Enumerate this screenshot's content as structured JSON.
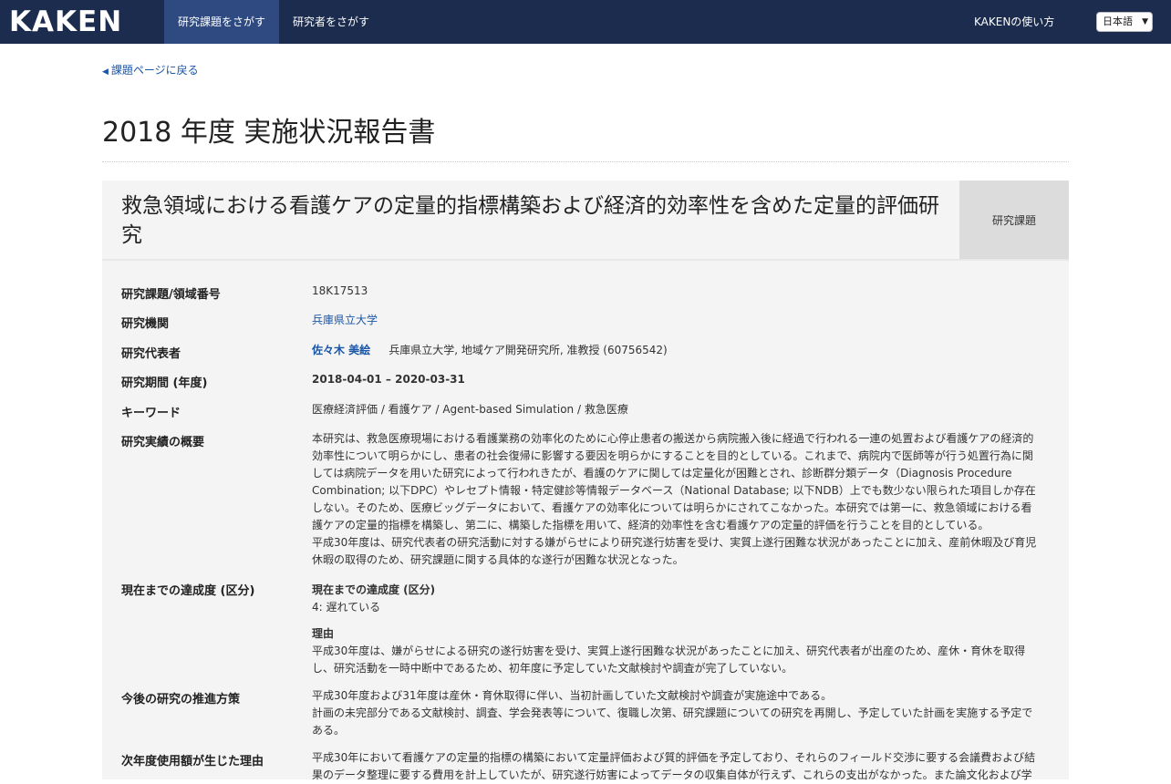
{
  "navbar": {
    "logo": "KAKEN",
    "tabs": [
      {
        "label": "研究課題をさがす"
      },
      {
        "label": "研究者をさがす"
      }
    ],
    "help_label": "KAKENの使い方",
    "language": "日本語"
  },
  "back_link": "課題ページに戻る",
  "page_title": "2018 年度 実施状況報告書",
  "project": {
    "title": "救急領域における看護ケアの定量的指標構築および経済的効率性を含めた定量的評価研究",
    "badge": "研究課題"
  },
  "rows": {
    "number": {
      "label": "研究課題/領域番号",
      "value": "18K17513"
    },
    "institution": {
      "label": "研究機関",
      "value": "兵庫県立大学"
    },
    "pi": {
      "label": "研究代表者",
      "name": "佐々木 美絵",
      "affiliation": "兵庫県立大学, 地域ケア開発研究所, 准教授 (60756542)"
    },
    "period": {
      "label": "研究期間 (年度)",
      "value": "2018-04-01 – 2020-03-31"
    },
    "keywords": {
      "label": "キーワード",
      "value": "医療経済評価 / 看護ケア / Agent-based Simulation / 救急医療"
    },
    "summary": {
      "label": "研究実績の概要",
      "para1": "本研究は、救急医療現場における看護業務の効率化のために心停止患者の搬送から病院搬入後に経過で行われる一連の処置および看護ケアの経済的効率性について明らかにし、患者の社会復帰に影響する要因を明らかにすることを目的としている。これまで、病院内で医師等が行う処置行為に関しては病院データを用いた研究によって行われきたが、看護のケアに関しては定量化が困難とされ、診断群分類データ（Diagnosis Procedure Combination; 以下DPC）やレセプト情報・特定健診等情報データベース（National Database; 以下NDB）上でも数少ない限られた項目しか存在しない。そのため、医療ビッグデータにおいて、看護ケアの効率化については明らかにされてこなかった。本研究では第一に、救急領域における看護ケアの定量的指標を構築し、第二に、構築した指標を用いて、経済的効率性を含む看護ケアの定量的評価を行うことを目的としている。",
      "para2": "平成30年度は、研究代表者の研究活動に対する嫌がらせにより研究遂行妨害を受け、実質上遂行困難な状況があったことに加え、産前休暇及び育児休暇の取得のため、研究課題に関する具体的な遂行が困難な状況となった。"
    },
    "progress": {
      "label": "現在までの達成度 (区分)",
      "sub_label": "現在までの達成度 (区分)",
      "value": "4: 遅れている",
      "reason_label": "理由",
      "reason": "平成30年度は、嫌がらせによる研究の遂行妨害を受け、実質上遂行困難な状況があったことに加え、研究代表者が出産のため、産休・育休を取得し、研究活動を一時中断中であるため、初年度に予定していた文献検討や調査が完了していない。"
    },
    "plan": {
      "label": "今後の研究の推進方策",
      "para1": "平成30年度および31年度は産休・育休取得に伴い、当初計画していた文献検討や調査が実施途中である。",
      "para2": "計画の未完部分である文献検討、調査、学会発表等について、復職し次第、研究課題についての研究を再開し、予定していた計画を実施する予定である。"
    },
    "carryover": {
      "label": "次年度使用額が生じた理由",
      "para1": "平成30年において看護ケアの定量的指標の構築において定量評価および質的評価を予定しており、それらのフィールド交渉に要する会議費および結果のデータ整理に要する費用を計上していたが、研究遂行妨害によってデータの収集自体が行えず、これらの支出がなかった。また論文化および学"
    }
  }
}
